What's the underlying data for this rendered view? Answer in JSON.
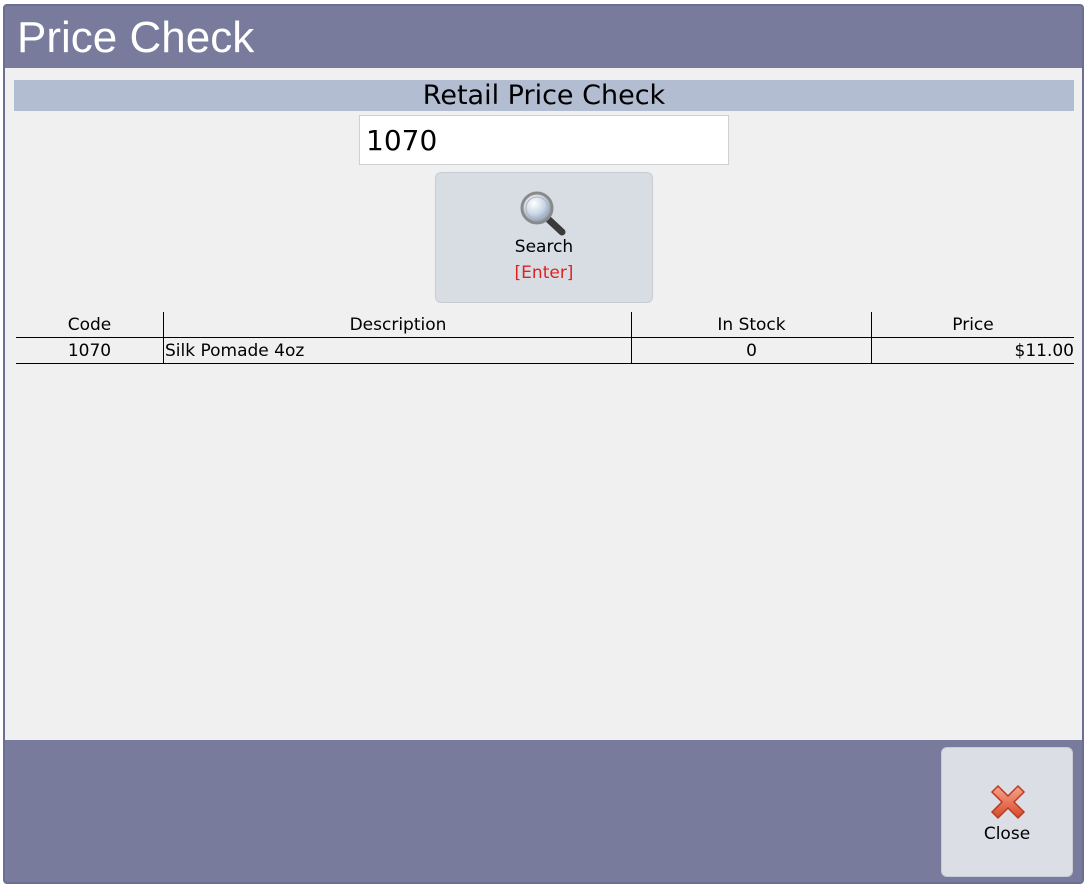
{
  "window": {
    "title": "Price Check"
  },
  "panel": {
    "header": "Retail Price Check"
  },
  "search": {
    "value": "1070",
    "button_label": "Search",
    "shortcut": "[Enter]",
    "icon": "magnifier-icon"
  },
  "table": {
    "columns": [
      "Code",
      "Description",
      "In Stock",
      "Price"
    ],
    "rows": [
      {
        "code": "1070",
        "description": "Silk Pomade 4oz",
        "in_stock": "0",
        "price": "$11.00"
      }
    ]
  },
  "footer": {
    "close_label": "Close",
    "close_icon": "close-x-icon"
  },
  "colors": {
    "title_bar": "#797b9d",
    "content_bg": "#f0f0f0",
    "section_header": "#b2bdd1",
    "button_bg": "#d8dde4",
    "shortcut_text": "#e02020"
  }
}
